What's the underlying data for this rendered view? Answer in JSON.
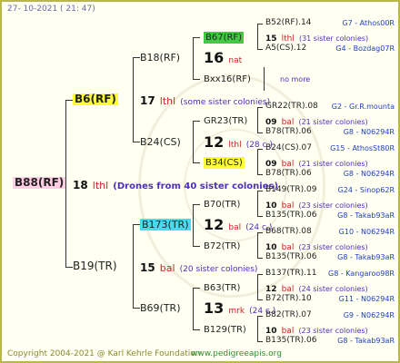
{
  "header": {
    "date": "27- 10-2021 ( 21: 47)"
  },
  "footer": {
    "copyright": "Copyright 2004-2021 @ Karl Kehrle Foundation",
    "website": "www.pedigreeapis.org"
  },
  "root": {
    "name": "B88(RF)",
    "num": "18",
    "type": "lthl",
    "note": "(Drones from 40 sister colonies)"
  },
  "gen1": [
    {
      "name": "B6(RF)",
      "num": "17",
      "type": "lthl",
      "note": "(some sister colonies)"
    },
    {
      "name": "B19(TR)",
      "num": "15",
      "type": "bal",
      "note": "(20 sister colonies)"
    }
  ],
  "gen2": [
    {
      "name": "B18(RF)",
      "num": "16",
      "type": "nat",
      "note": ""
    },
    {
      "name": "B24(CS)",
      "num": "12",
      "type": "lthl",
      "note": "(28 c.)"
    },
    {
      "name": "B173(TR)",
      "num": "12",
      "type": "bal",
      "note": "(24 c.)"
    },
    {
      "name": "B69(TR)",
      "num": "13",
      "type": "mrk",
      "note": "(24 c.)"
    }
  ],
  "gen3": [
    {
      "name": "B67(RF)"
    },
    {
      "name": "Bxx16(RF)"
    },
    {
      "name": "GR23(TR)",
      "num": "09",
      "type": "bal",
      "note": "(21 sister colonies)"
    },
    {
      "name": "B34(CS)",
      "num": "09",
      "type": "bal",
      "note": "(21 sister colonies)"
    },
    {
      "name": "B70(TR)",
      "num": "10",
      "type": "bal",
      "note": "(23 sister colonies)"
    },
    {
      "name": "B72(TR)",
      "num": "10",
      "type": "bal",
      "note": "(23 sister colonies)"
    },
    {
      "name": "B63(TR)",
      "num": "12",
      "type": "bal",
      "note": "(24 sister colonies)"
    },
    {
      "name": "B129(TR)",
      "num": "10",
      "type": "bal",
      "note": "(23 sister colonies)"
    }
  ],
  "leaves": [
    {
      "name": "B52(RF).14",
      "loc": "G7 - Athos00R"
    },
    {
      "num": "15",
      "type": "lthl",
      "note": "(31 sister colonies)"
    },
    {
      "name": "A5(CS).12",
      "loc": "G4 - Bozdag07R"
    },
    {
      "more": "no more"
    },
    {
      "name": "GR22(TR).08",
      "loc": "G2 - Gr.R.mounta"
    },
    {
      "name": "B78(TR).06",
      "loc": "G8 - N06294R"
    },
    {
      "name": "B24(CS).07",
      "loc": "G15 - AthosSt80R"
    },
    {
      "name": "B78(TR).06",
      "loc": "G8 - N06294R"
    },
    {
      "name": "B149(TR).09",
      "loc": "G24 - Sinop62R"
    },
    {
      "name": "B135(TR).06",
      "loc": "G8 - Takab93aR"
    },
    {
      "name": "B68(TR).08",
      "loc": "G10 - N06294R"
    },
    {
      "name": "B135(TR).06",
      "loc": "G8 - Takab93aR"
    },
    {
      "name": "B137(TR).11",
      "loc": "G8 - Kangaroo98R"
    },
    {
      "name": "B72(TR).10",
      "loc": "G11 - N06294R"
    },
    {
      "name": "B82(TR).07",
      "loc": "G9 - N06294R"
    },
    {
      "name": "B135(TR).06",
      "loc": "G8 - Takab93aR"
    }
  ],
  "colors": {
    "frame": "#b8b84a",
    "background": "#fffff2",
    "nat": "#cc2222",
    "note": "#4c2fbf",
    "location": "#1f3fbf",
    "queen_yellow": "#ffff33",
    "queen_pink": "#ffcde4",
    "queen_cyan": "#44ddf0",
    "queen_green": "#44c944"
  }
}
